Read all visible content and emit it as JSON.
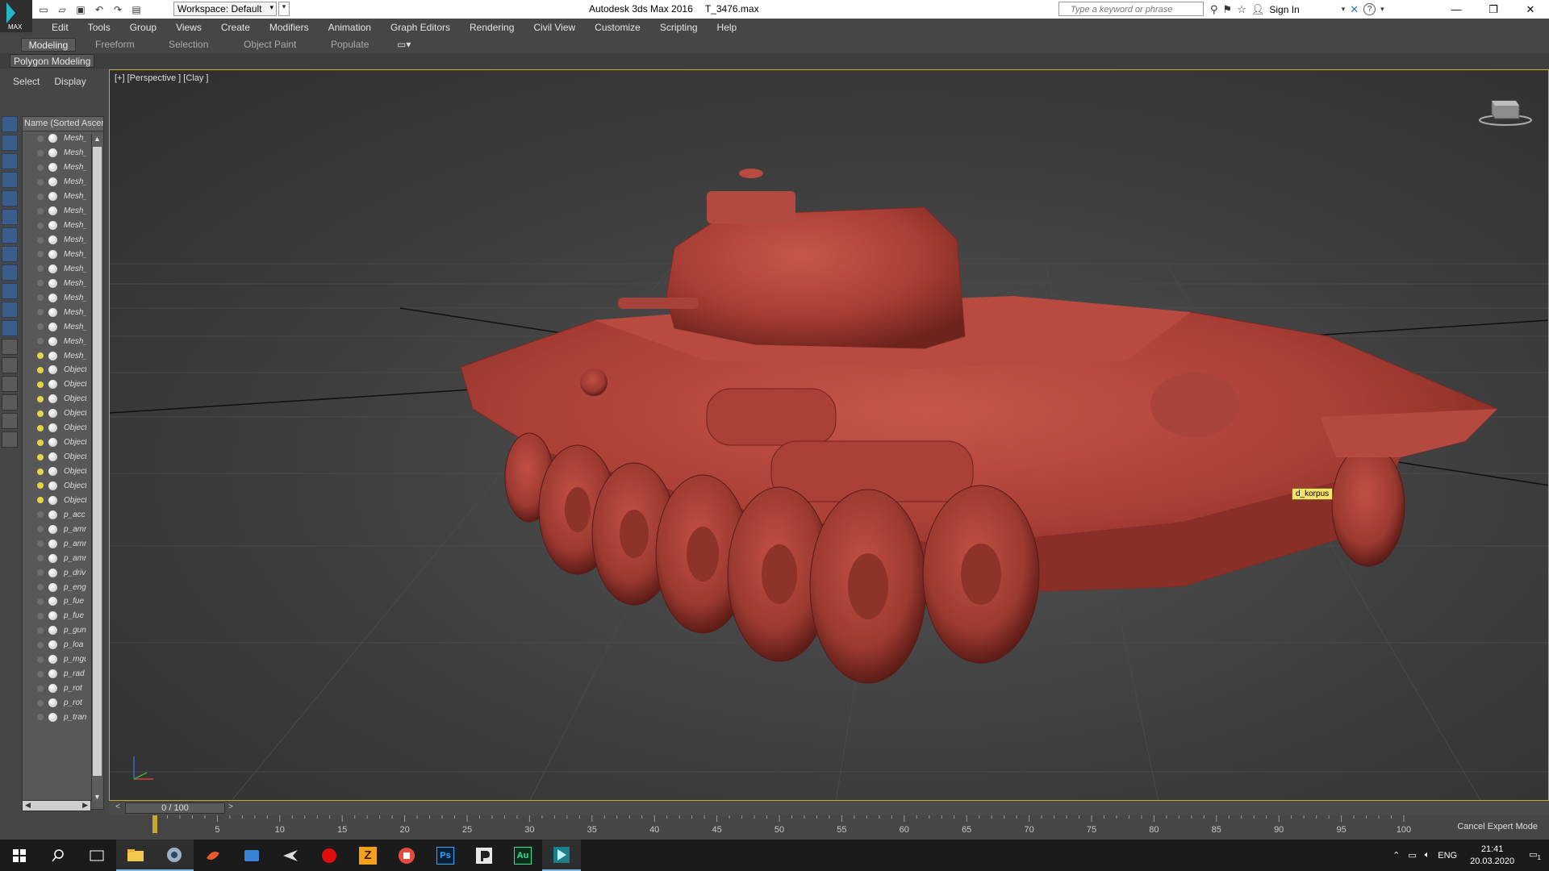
{
  "titlebar": {
    "app_logo_label": "MAX",
    "workspace": "Workspace: Default",
    "app_title": "Autodesk 3ds Max 2016",
    "file_name": "T_3476.max",
    "search_placeholder": "Type a keyword or phrase",
    "sign_in": "Sign In",
    "help": "?"
  },
  "menu": [
    "Edit",
    "Tools",
    "Group",
    "Views",
    "Create",
    "Modifiers",
    "Animation",
    "Graph Editors",
    "Rendering",
    "Civil View",
    "Customize",
    "Scripting",
    "Help"
  ],
  "ribbon": {
    "tabs": [
      "Modeling",
      "Freeform",
      "Selection",
      "Object Paint",
      "Populate"
    ],
    "active_tab": "Modeling",
    "sub_button": "Polygon Modeling"
  },
  "scene_explorer": {
    "menu": [
      "Select",
      "Display"
    ],
    "column_header": "Name (Sorted Ascending)",
    "items": [
      {
        "name": "Mesh_",
        "light": false
      },
      {
        "name": "Mesh_",
        "light": false
      },
      {
        "name": "Mesh_",
        "light": false
      },
      {
        "name": "Mesh_",
        "light": false
      },
      {
        "name": "Mesh_",
        "light": false
      },
      {
        "name": "Mesh_",
        "light": false
      },
      {
        "name": "Mesh_",
        "light": false
      },
      {
        "name": "Mesh_",
        "light": false
      },
      {
        "name": "Mesh_",
        "light": false
      },
      {
        "name": "Mesh_",
        "light": false
      },
      {
        "name": "Mesh_",
        "light": false
      },
      {
        "name": "Mesh_",
        "light": false
      },
      {
        "name": "Mesh_",
        "light": false
      },
      {
        "name": "Mesh_",
        "light": false
      },
      {
        "name": "Mesh_",
        "light": false
      },
      {
        "name": "Mesh_",
        "light": true
      },
      {
        "name": "Object",
        "light": true
      },
      {
        "name": "Object",
        "light": true
      },
      {
        "name": "Object",
        "light": true
      },
      {
        "name": "Object",
        "light": true
      },
      {
        "name": "Object",
        "light": true
      },
      {
        "name": "Object",
        "light": true
      },
      {
        "name": "Object",
        "light": true
      },
      {
        "name": "Object",
        "light": true
      },
      {
        "name": "Object",
        "light": true
      },
      {
        "name": "Object",
        "light": true
      },
      {
        "name": "p_acc",
        "light": false
      },
      {
        "name": "p_amr",
        "light": false
      },
      {
        "name": "p_amr",
        "light": false
      },
      {
        "name": "p_amr",
        "light": false
      },
      {
        "name": "p_driv",
        "light": false
      },
      {
        "name": "p_eng",
        "light": false
      },
      {
        "name": "p_fue",
        "light": false
      },
      {
        "name": "p_fue",
        "light": false
      },
      {
        "name": "p_gun",
        "light": false
      },
      {
        "name": "p_loa",
        "light": false
      },
      {
        "name": "p_mgu",
        "light": false
      },
      {
        "name": "p_rad",
        "light": false
      },
      {
        "name": "p_rot",
        "light": false
      },
      {
        "name": "p_rot",
        "light": false
      },
      {
        "name": "p_tran",
        "light": false
      }
    ]
  },
  "viewport": {
    "label": "[+] [Perspective ] [Clay ]",
    "tooltip": "d_korpus",
    "model_color": "#b8463c"
  },
  "timeline": {
    "frame_display": "0 / 100",
    "prev": "<",
    "next": ">",
    "tick_labels": [
      "0",
      "5",
      "10",
      "15",
      "20",
      "25",
      "30",
      "35",
      "40",
      "45",
      "50",
      "55",
      "60",
      "65",
      "70",
      "75",
      "80",
      "85",
      "90",
      "95",
      "100"
    ],
    "cancel_expert": "Cancel Expert Mode"
  },
  "taskbar": {
    "apps": [
      "start-icon",
      "search-icon",
      "task-view-icon",
      "file-explorer-icon",
      "app-icon",
      "app-icon",
      "app-icon",
      "app-icon",
      "app-icon",
      "app-icon",
      "app-icon",
      "photoshop-icon",
      "app-icon",
      "audition-icon",
      "3dsmax-icon"
    ],
    "app_labels": {
      "photoshop": "Ps",
      "audition": "Au",
      "zip": "Z"
    },
    "language": "ENG",
    "time": "21:41",
    "date": "20.03.2020",
    "notifications": "1"
  }
}
